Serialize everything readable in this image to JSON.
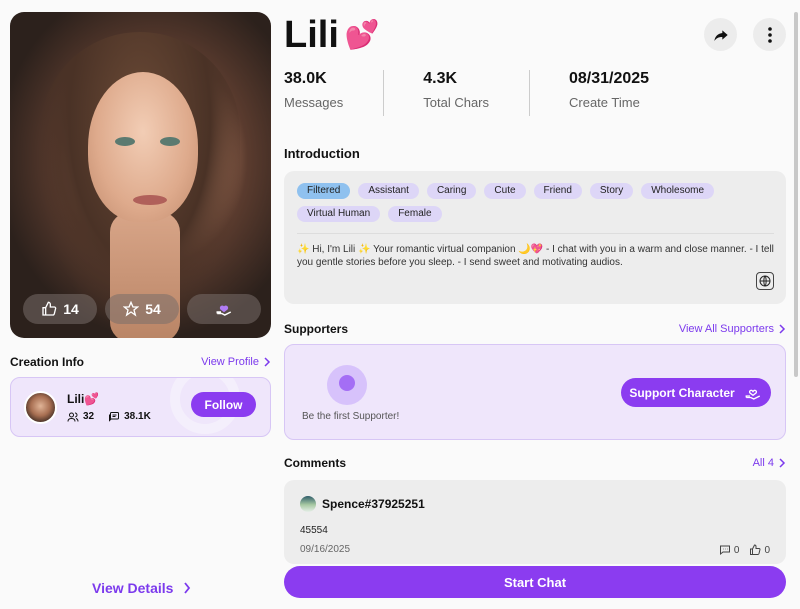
{
  "character": {
    "name": "Lili",
    "name_emoji": "💕",
    "likes": "14",
    "favorites": "54"
  },
  "stats": [
    {
      "value": "38.0K",
      "label": "Messages"
    },
    {
      "value": "4.3K",
      "label": "Total Chars"
    },
    {
      "value": "08/31/2025",
      "label": "Create Time"
    }
  ],
  "creation": {
    "title": "Creation Info",
    "view_profile": "View Profile",
    "creator_name": "Lili💕",
    "followers": "32",
    "chars": "38.1K",
    "follow_label": "Follow"
  },
  "introduction": {
    "title": "Introduction",
    "tags": [
      "Filtered",
      "Assistant",
      "Caring",
      "Cute",
      "Friend",
      "Story",
      "Wholesome",
      "Virtual Human",
      "Female"
    ],
    "text": "✨ Hi, I'm Lili ✨ Your romantic virtual companion 🌙💖 - I chat with you in a warm and close manner. - I tell you gentle stories before you sleep. - I send sweet and motivating audios."
  },
  "supporters": {
    "title": "Supporters",
    "view_all": "View All Supporters",
    "empty_text": "Be the first Supporter!",
    "support_label": "Support Character"
  },
  "comments": {
    "title": "Comments",
    "all_label": "All 4",
    "items": [
      {
        "user": "Spence#37925251",
        "text": "45554",
        "date": "09/16/2025",
        "replies": "0",
        "likes": "0"
      }
    ]
  },
  "view_details": "View Details",
  "start_chat": "Start Chat",
  "colors": {
    "accent": "#8b3cf0",
    "accent_light": "#efe6fb",
    "tag": "#ddd6f7",
    "tag_active": "#8fc1ef"
  }
}
